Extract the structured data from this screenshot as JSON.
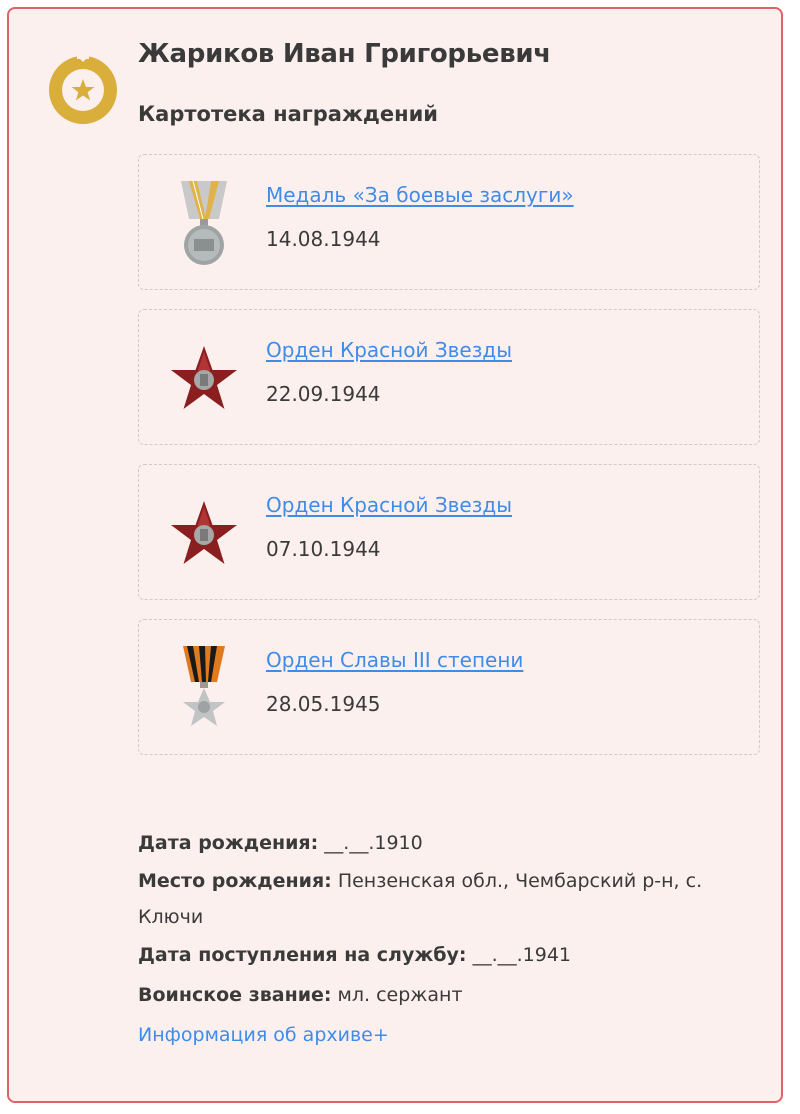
{
  "person": {
    "name": "Жариков Иван Григорьевич",
    "section_title": "Картотека награждений"
  },
  "awards": [
    {
      "title": "Медаль «За боевые заслуги»",
      "date": "14.08.1944",
      "icon": "medal-for-combat-merit-icon"
    },
    {
      "title": "Орден Красной Звезды",
      "date": "22.09.1944",
      "icon": "order-red-star-icon"
    },
    {
      "title": "Орден Красной Звезды",
      "date": "07.10.1944",
      "icon": "order-red-star-icon"
    },
    {
      "title": "Орден Славы III степени",
      "date": "28.05.1945",
      "icon": "order-of-glory-icon"
    }
  ],
  "details": {
    "birth_date_label": "Дата рождения:",
    "birth_date_value": "__.__.1910",
    "birth_place_label": "Место рождения:",
    "birth_place_value": "Пензенская обл., Чембарский р-н, с. Ключи",
    "service_start_label": "Дата поступления на службу:",
    "service_start_value": "__.__.1941",
    "rank_label": "Воинское звание:",
    "rank_value": "мл. сержант",
    "archive_link": "Информация об архиве+"
  },
  "colors": {
    "card_background": "#fcf0ee",
    "card_border": "#dc6467",
    "link": "#3f8ce8",
    "badge_gold": "#d9ae3b"
  }
}
